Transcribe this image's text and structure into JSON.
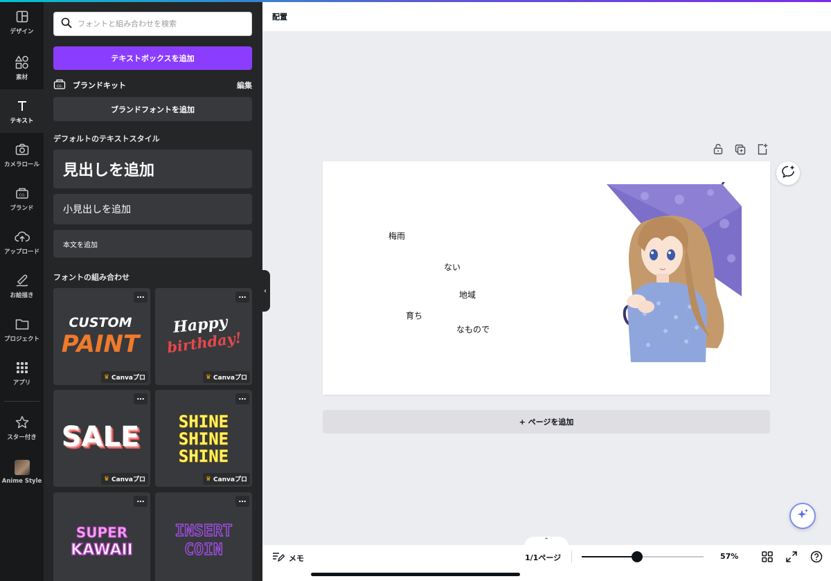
{
  "rail": {
    "items": [
      {
        "label": "デザイン",
        "icon": "layout-icon"
      },
      {
        "label": "素材",
        "icon": "shapes-icon"
      },
      {
        "label": "テキスト",
        "icon": "text-icon"
      },
      {
        "label": "カメラロール",
        "icon": "camera-icon"
      },
      {
        "label": "ブランド",
        "icon": "brand-icon"
      },
      {
        "label": "アップロード",
        "icon": "upload-icon"
      },
      {
        "label": "お絵描き",
        "icon": "draw-icon"
      },
      {
        "label": "プロジェクト",
        "icon": "folder-icon"
      },
      {
        "label": "アプリ",
        "icon": "apps-icon"
      },
      {
        "label": "スター付き",
        "icon": "star-icon"
      },
      {
        "label": "Anime Style",
        "icon": "avatar"
      }
    ],
    "active_index": 2
  },
  "panel": {
    "search_placeholder": "フォントと組み合わせを検索",
    "add_textbox": "テキストボックスを追加",
    "brandkit_label": "ブランドキット",
    "brandkit_edit": "編集",
    "add_brand_font": "ブランドフォントを追加",
    "default_styles_title": "デフォルトのテキストスタイル",
    "heading": "見出しを追加",
    "subheading": "小見出しを追加",
    "body": "本文を追加",
    "combos_title": "フォントの組み合わせ",
    "pro_badge": "Canvaプロ",
    "more": "…",
    "tiles": [
      {
        "line1": "CUSTOM",
        "line2": "PAINT"
      },
      {
        "line1": "Happy",
        "line2": "birthday!"
      },
      {
        "line1": "SALE"
      },
      {
        "line1": "SHINE",
        "line2": "SHINE",
        "line3": "SHINE"
      },
      {
        "line1": "SUPER",
        "line2": "KAWAII"
      },
      {
        "line1": "INSERT",
        "line2": "COIN"
      }
    ]
  },
  "toolbar": {
    "arrange": "配置"
  },
  "canvas": {
    "texts": [
      "梅雨",
      "ない",
      "地域",
      "育ち",
      "なもので"
    ],
    "add_page": "+ ページを追加"
  },
  "bottom": {
    "memo": "メモ",
    "pages": "1/1ページ",
    "zoom": 57,
    "zoom_label": "57%"
  },
  "colors": {
    "accent": "#8b3dff",
    "rail_bg": "#18191b",
    "panel_bg": "#252627"
  }
}
